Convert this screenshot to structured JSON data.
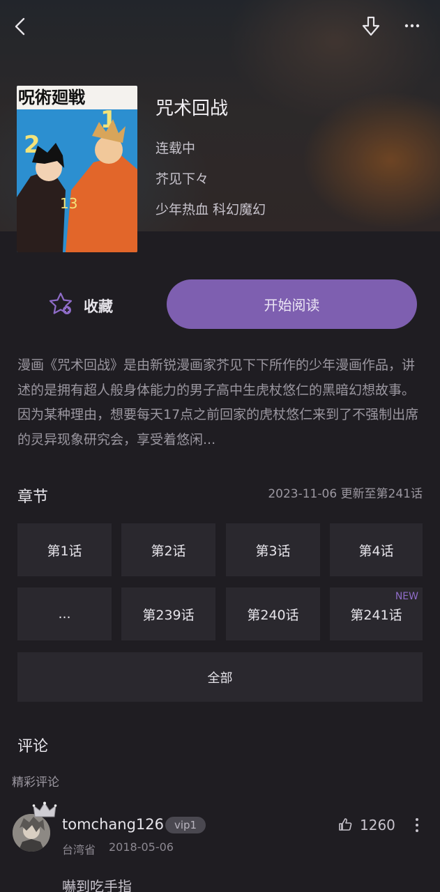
{
  "header": {
    "back_icon": "chevron-left-icon",
    "download_icon": "download-icon",
    "more_icon": "more-horizontal-icon"
  },
  "comic": {
    "title": "咒术回战",
    "status": "连载中",
    "author": "芥见下々",
    "tags": "少年热血 科幻魔幻",
    "cover_text": "呪術廻戦",
    "description": "漫画《咒术回战》是由新锐漫画家芥见下下所作的少年漫画作品，讲述的是拥有超人般身体能力的男子高中生虎杖悠仁的黑暗幻想故事。因为某种理由，想要每天17点之前回家的虎杖悠仁来到了不强制出席的灵异现象研究会，享受着悠闲..."
  },
  "actions": {
    "favorite_label": "收藏",
    "read_label": "开始阅读"
  },
  "chapters": {
    "title": "章节",
    "update_info": "2023-11-06 更新至第241话",
    "items": [
      {
        "label": "第1话"
      },
      {
        "label": "第2话"
      },
      {
        "label": "第3话"
      },
      {
        "label": "第4话"
      },
      {
        "label": "..."
      },
      {
        "label": "第239话"
      },
      {
        "label": "第240话"
      },
      {
        "label": "第241话",
        "badge": "NEW"
      }
    ],
    "all_label": "全部"
  },
  "comments": {
    "title": "评论",
    "featured_label": "精彩评论",
    "items": [
      {
        "username": "tomchang126",
        "vip": "vip1",
        "region": "台湾省",
        "date": "2018-05-06",
        "likes": "1260",
        "text": "嚇到吃手指"
      }
    ]
  },
  "colors": {
    "accent": "#7e5fb0",
    "background": "#1f1d22",
    "tile": "#2a282e",
    "badge": "#8f6cc8"
  }
}
